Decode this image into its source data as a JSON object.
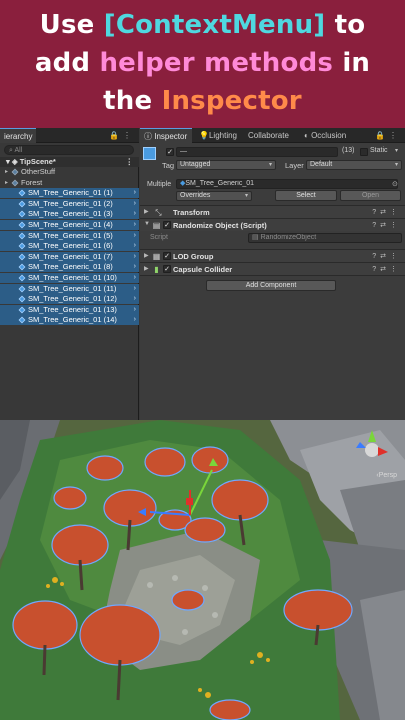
{
  "banner": {
    "line1_a": "Use ",
    "line1_b": "[ContextMenu]",
    "line1_c": " to",
    "line2_a": "add ",
    "line2_b": "helper methods",
    "line2_c": " in",
    "line3_a": "the ",
    "line3_b": "Inspector",
    "colors": {
      "background": "#8a1f3d",
      "cyan": "#4fd8e0",
      "pink": "#ff8ad8",
      "orange": "#ff8a4a"
    }
  },
  "hierarchy": {
    "tab_label": "ierarchy",
    "search_placeholder": "All",
    "scene_name": "TipScene*",
    "items": [
      {
        "label": "OtherStuff",
        "indent": 1,
        "selected": false,
        "expandable": true
      },
      {
        "label": "Forest",
        "indent": 1,
        "selected": false,
        "expandable": true
      },
      {
        "label": "SM_Tree_Generic_01 (1)",
        "indent": 2,
        "selected": true,
        "expandable": false
      },
      {
        "label": "SM_Tree_Generic_01 (2)",
        "indent": 2,
        "selected": true,
        "expandable": false
      },
      {
        "label": "SM_Tree_Generic_01 (3)",
        "indent": 2,
        "selected": true,
        "expandable": false
      },
      {
        "label": "SM_Tree_Generic_01 (4)",
        "indent": 2,
        "selected": true,
        "expandable": false
      },
      {
        "label": "SM_Tree_Generic_01 (5)",
        "indent": 2,
        "selected": true,
        "expandable": false
      },
      {
        "label": "SM_Tree_Generic_01 (6)",
        "indent": 2,
        "selected": true,
        "expandable": false
      },
      {
        "label": "SM_Tree_Generic_01 (7)",
        "indent": 2,
        "selected": true,
        "expandable": false
      },
      {
        "label": "SM_Tree_Generic_01 (8)",
        "indent": 2,
        "selected": true,
        "expandable": false
      },
      {
        "label": "SM_Tree_Generic_01 (10)",
        "indent": 2,
        "selected": true,
        "expandable": false
      },
      {
        "label": "SM_Tree_Generic_01 (11)",
        "indent": 2,
        "selected": true,
        "expandable": false
      },
      {
        "label": "SM_Tree_Generic_01 (12)",
        "indent": 2,
        "selected": true,
        "expandable": false
      },
      {
        "label": "SM_Tree_Generic_01 (13)",
        "indent": 2,
        "selected": true,
        "expandable": false
      },
      {
        "label": "SM_Tree_Generic_01 (14)",
        "indent": 2,
        "selected": true,
        "expandable": false
      }
    ]
  },
  "inspector": {
    "tabs": [
      "Inspector",
      "Lighting",
      "Collaborate",
      "Occlusion"
    ],
    "name_value": "—",
    "count": "(13)",
    "static_label": "Static",
    "tag_label": "Tag",
    "tag_value": "Untagged",
    "layer_label": "Layer",
    "layer_value": "Default",
    "multiple_label": "Multiple",
    "multiple_value": "SM_Tree_Generic_01",
    "overrides_label": "Overrides",
    "select_label": "Select",
    "open_label": "Open",
    "components": [
      {
        "name": "Transform",
        "icon": "transform-icon",
        "checkbox": false
      },
      {
        "name": "Randomize Object (Script)",
        "icon": "script-icon",
        "checkbox": true
      }
    ],
    "script_label": "Script",
    "script_value": "RandomizeObject",
    "components2": [
      {
        "name": "LOD Group",
        "icon": "lod-group-icon",
        "checkbox": true
      },
      {
        "name": "Capsule Collider",
        "icon": "capsule-collider-icon",
        "checkbox": true
      }
    ],
    "add_component_label": "Add Component"
  },
  "scene_view": {
    "projection_label": "‹Persp"
  }
}
